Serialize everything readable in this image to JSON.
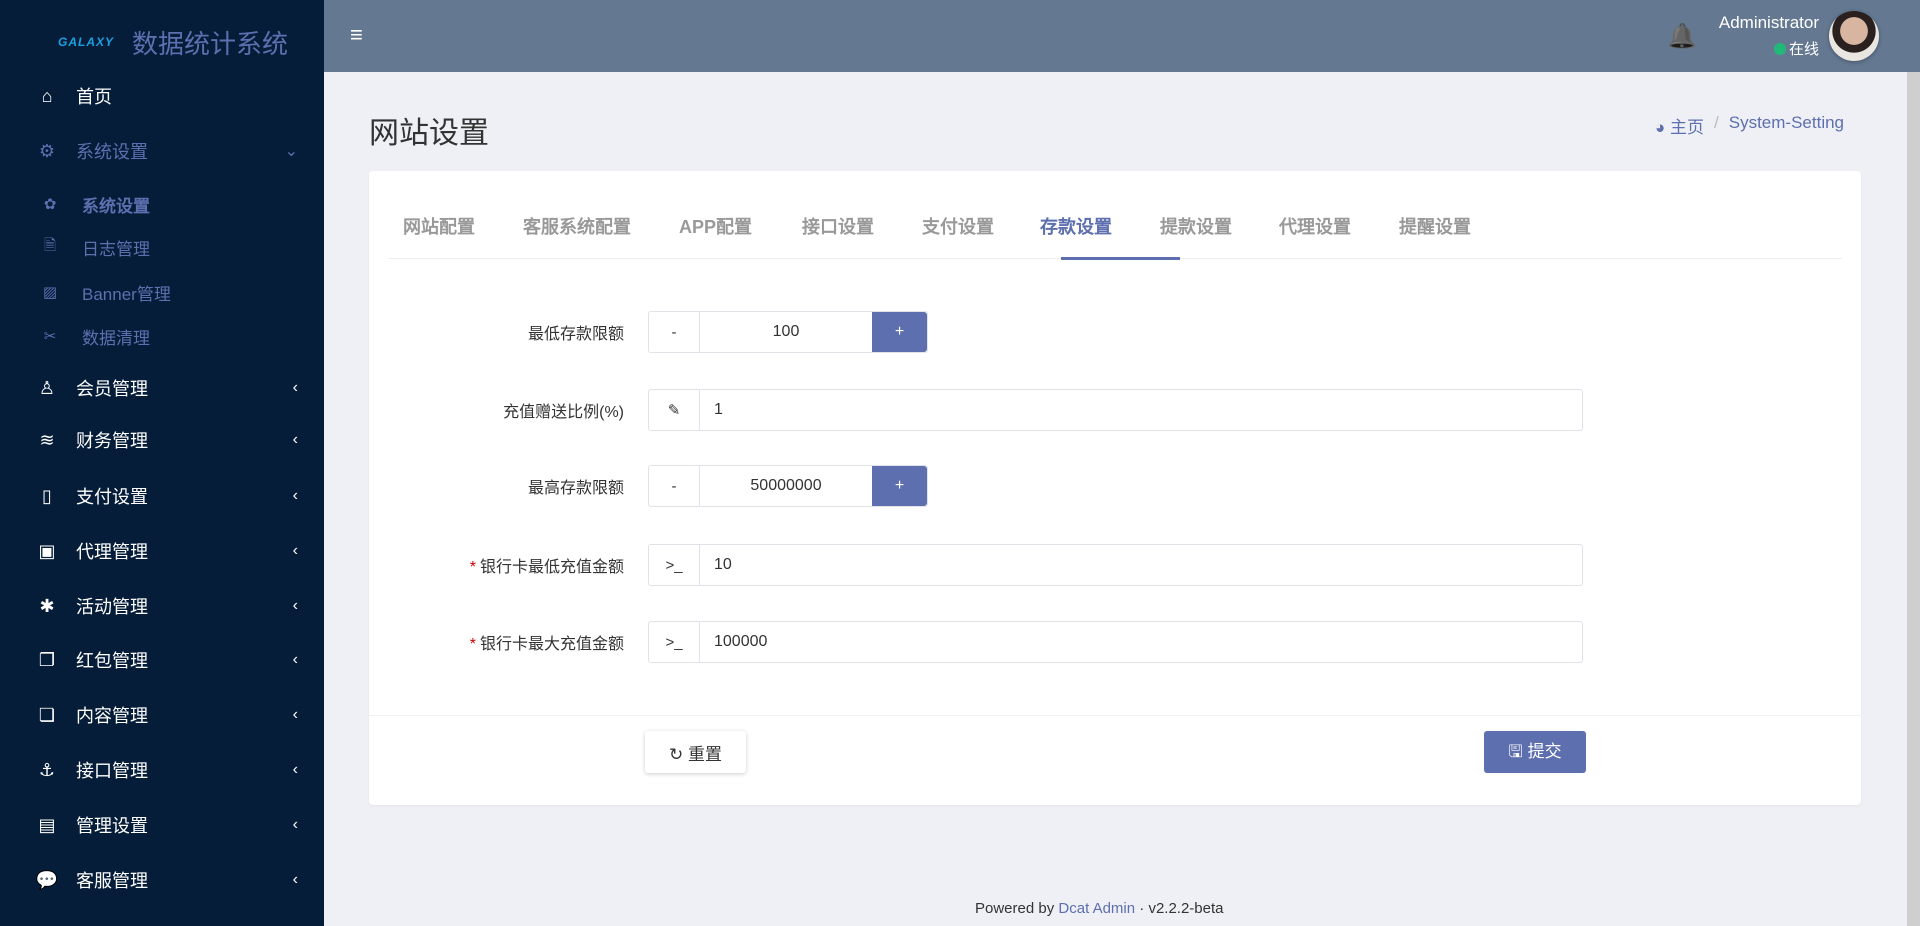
{
  "brand": {
    "logo": "GALAXY",
    "title": "数据统计系统"
  },
  "sidebar": {
    "items": [
      {
        "label": "首页",
        "icon": "home-icon",
        "glyph": "⌂"
      },
      {
        "label": "系统设置",
        "icon": "cogs-icon",
        "glyph": "⚙",
        "chevron": "⌄"
      },
      {
        "label": "会员管理",
        "icon": "user-icon",
        "glyph": "♙",
        "chevron": "‹"
      },
      {
        "label": "财务管理",
        "icon": "database-icon",
        "glyph": "≋",
        "chevron": "‹"
      },
      {
        "label": "支付设置",
        "icon": "bookmark-icon",
        "glyph": "▯",
        "chevron": "‹"
      },
      {
        "label": "代理管理",
        "icon": "contact-icon",
        "glyph": "▣",
        "chevron": "‹"
      },
      {
        "label": "活动管理",
        "icon": "yelp-icon",
        "glyph": "✱",
        "chevron": "‹"
      },
      {
        "label": "红包管理",
        "icon": "clone-icon",
        "glyph": "❐",
        "chevron": "‹"
      },
      {
        "label": "内容管理",
        "icon": "copy-icon",
        "glyph": "❏",
        "chevron": "‹"
      },
      {
        "label": "接口管理",
        "icon": "anchor-icon",
        "glyph": "⚓",
        "chevron": "‹"
      },
      {
        "label": "管理设置",
        "icon": "id-card-icon",
        "glyph": "▤",
        "chevron": "‹"
      },
      {
        "label": "客服管理",
        "icon": "comments-icon",
        "glyph": "💬",
        "chevron": "‹"
      }
    ],
    "sub_items": [
      {
        "label": "系统设置",
        "icon": "cog-icon",
        "glyph": "✿"
      },
      {
        "label": "日志管理",
        "icon": "file-icon",
        "glyph": "🗎"
      },
      {
        "label": "Banner管理",
        "icon": "image-icon",
        "glyph": "▨"
      },
      {
        "label": "数据清理",
        "icon": "scissors-icon",
        "glyph": "✂"
      }
    ]
  },
  "header": {
    "menu_glyph": "≡",
    "bell_glyph": "🔔",
    "user": "Administrator",
    "status": "在线",
    "status_color": "#21b978"
  },
  "page": {
    "title": "网站设置",
    "breadcrumb": {
      "home": "主页",
      "sep": "/",
      "current": "System-Setting"
    }
  },
  "tabs": [
    "网站配置",
    "客服系统配置",
    "APP配置",
    "接口设置",
    "支付设置",
    "存款设置",
    "提款设置",
    "代理设置",
    "提醒设置"
  ],
  "active_tab": "存款设置",
  "form": [
    {
      "label": "最低存款限额",
      "type": "stepper",
      "minus": "-",
      "value": "100",
      "plus": "+"
    },
    {
      "label": "充值赠送比例(%)",
      "type": "text",
      "addon": "✎",
      "value": "1"
    },
    {
      "label": "最高存款限额",
      "type": "stepper",
      "minus": "-",
      "value": "50000000",
      "plus": "+"
    },
    {
      "label": "银行卡最低充值金额",
      "required": "*",
      "type": "text",
      "addon": ">_",
      "value": "10"
    },
    {
      "label": "银行卡最大充值金额",
      "required": "*",
      "type": "text",
      "addon": ">_",
      "value": "100000"
    }
  ],
  "buttons": {
    "reset": "↻ 重置",
    "submit": "🖫 提交"
  },
  "footer": {
    "prefix": "Powered by",
    "link": "Dcat Admin",
    "dot": "·",
    "version": "v2.2.2-beta"
  },
  "colors": {
    "accent": "#5d6fae",
    "sidebar": "#051d39",
    "header": "#647891"
  }
}
